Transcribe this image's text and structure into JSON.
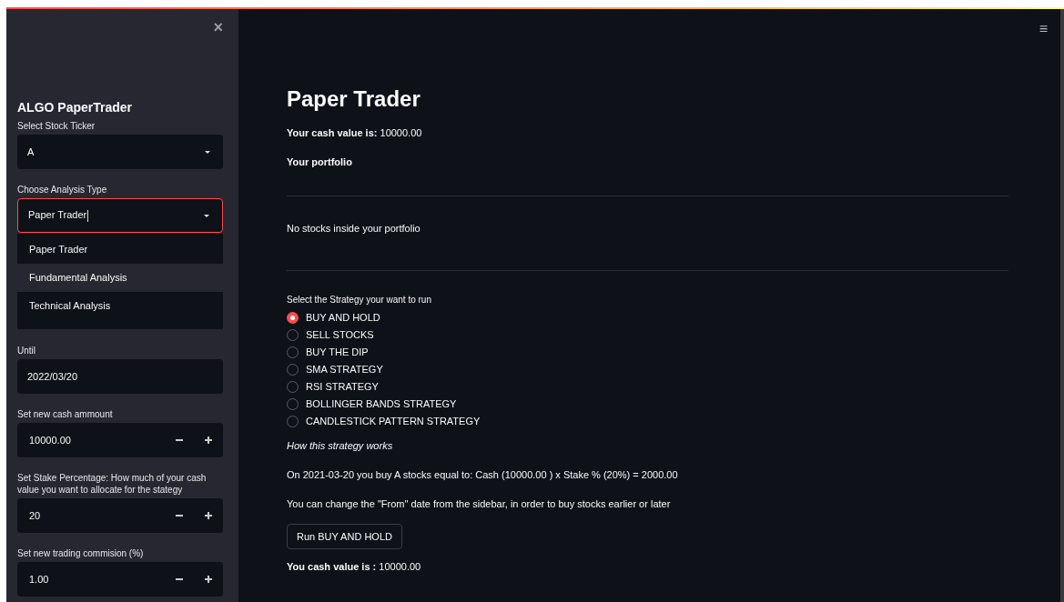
{
  "sidebar": {
    "close_icon": "×",
    "title": "ALGO PaperTrader",
    "ticker": {
      "label": "Select Stock Ticker",
      "value": "A"
    },
    "analysis": {
      "label": "Choose Analysis Type",
      "value": "Paper Trader",
      "focused": true,
      "options": [
        {
          "label": "Paper Trader",
          "highlighted": false
        },
        {
          "label": "Fundamental Analysis",
          "highlighted": true
        },
        {
          "label": "Technical Analysis",
          "highlighted": false
        }
      ]
    },
    "until": {
      "label": "Until",
      "value": "2022/03/20"
    },
    "numbers": [
      {
        "label": "Set new cash ammount",
        "value": "10000.00"
      },
      {
        "label": "Set Stake Percentage: How much of your cash value you want to allocate for the stategy",
        "value": "20"
      },
      {
        "label": "Set new trading commision (%)",
        "value": "1.00"
      }
    ]
  },
  "main": {
    "menu_icon": "≡",
    "title": "Paper Trader",
    "cash": {
      "label": "Your cash value is:",
      "value": "10000.00"
    },
    "portfolio_heading": "Your portfolio",
    "portfolio_empty": "No stocks inside your portfolio",
    "strategy": {
      "label": "Select the Strategy your want to run",
      "options": [
        {
          "label": "BUY AND HOLD",
          "selected": true
        },
        {
          "label": "SELL STOCKS",
          "selected": false
        },
        {
          "label": "BUY THE DIP",
          "selected": false
        },
        {
          "label": "SMA STRATEGY",
          "selected": false
        },
        {
          "label": "RSI STRATEGY",
          "selected": false
        },
        {
          "label": "BOLLINGER BANDS STRATEGY",
          "selected": false
        },
        {
          "label": "CANDLESTICK PATTERN STRATEGY",
          "selected": false
        }
      ]
    },
    "how_heading": "How this strategy works",
    "explanation": "On 2021-03-20 you buy A stocks equal to: Cash (10000.00 ) x Stake % (20%) = 2000.00",
    "hint": "You can change the \"From\" date from the sidebar, in order to buy stocks earlier or later",
    "run_button": "Run BUY AND HOLD",
    "result": {
      "label": "You cash value is :",
      "value": "10000.00"
    }
  }
}
